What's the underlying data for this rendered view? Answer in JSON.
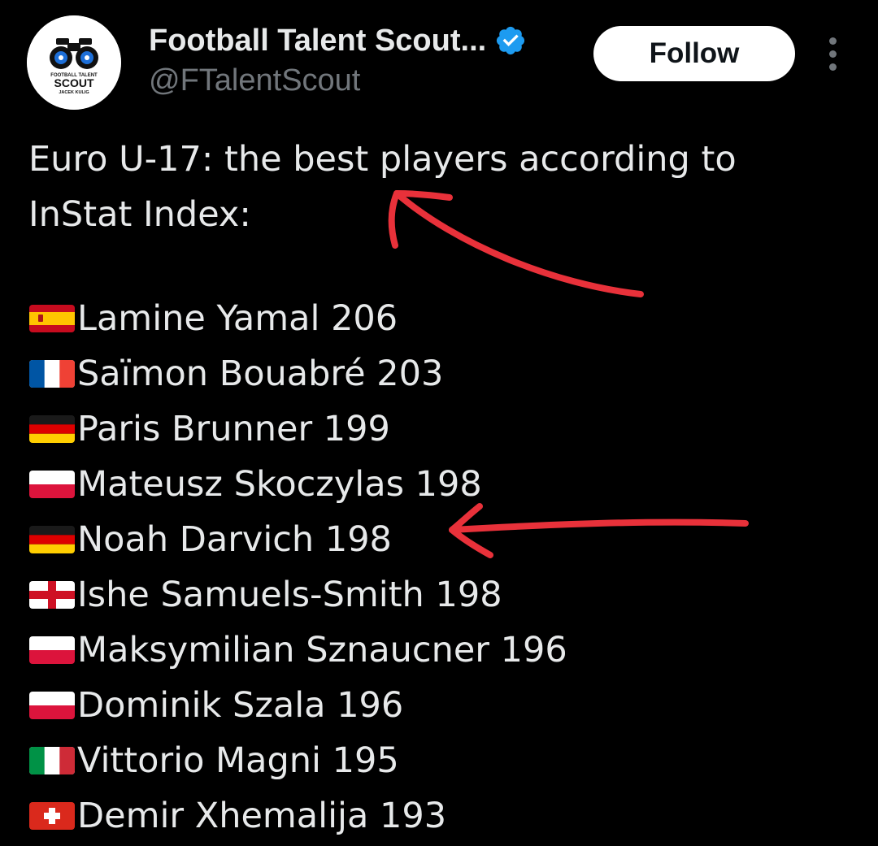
{
  "account": {
    "display_name": "Football Talent Scout...",
    "handle": "@FTalentScout",
    "verified": true,
    "avatar_text": [
      "FOOTBALL TALENT",
      "SCOUT",
      "JACEK KULIG"
    ]
  },
  "actions": {
    "follow_label": "Follow",
    "more_icon": "more-vertical-icon"
  },
  "tweet": {
    "intro": "Euro U-17: the best players according to InStat Index:",
    "players": [
      {
        "flag": "spain",
        "text": "Lamine Yamal 206"
      },
      {
        "flag": "france",
        "text": "Saïmon Bouabré 203"
      },
      {
        "flag": "germany",
        "text": "Paris Brunner 199"
      },
      {
        "flag": "poland",
        "text": "Mateusz Skoczylas 198"
      },
      {
        "flag": "germany",
        "text": "Noah Darvich 198"
      },
      {
        "flag": "england",
        "text": "Ishe Samuels-Smith 198"
      },
      {
        "flag": "poland",
        "text": "Maksymilian Sznaucner 196"
      },
      {
        "flag": "poland",
        "text": "Dominik Szala 196"
      },
      {
        "flag": "italy",
        "text": "Vittorio Magni 195"
      },
      {
        "flag": "switzerland",
        "text": "Demir Xhemalija 193"
      }
    ]
  },
  "colors": {
    "background": "#000000",
    "text": "#e7e9ea",
    "secondary_text": "#71767b",
    "verified_badge": "#1d9bf0",
    "follow_button_bg": "#ffffff",
    "annotation_arrow": "#e8313a"
  }
}
